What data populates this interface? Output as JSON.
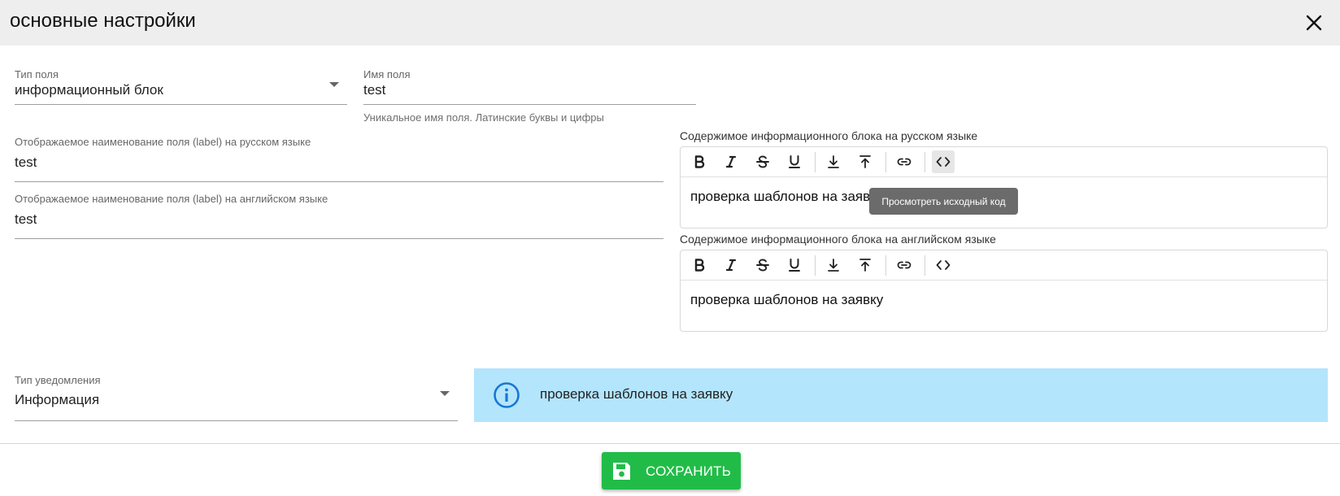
{
  "header": {
    "title": "основные настройки"
  },
  "form": {
    "field_type": {
      "label": "Тип поля",
      "value": "информационный блок"
    },
    "field_name": {
      "label": "Имя поля",
      "value": "test",
      "hint": "Уникальное имя поля. Латинские буквы и цифры"
    },
    "label_ru": {
      "label": "Отображаемое наименование поля (label) на русском языке",
      "value": "test"
    },
    "label_en": {
      "label": "Отображаемое наименование поля (label) на английском языке",
      "value": "test"
    },
    "notification_type": {
      "label": "Тип уведомления",
      "value": "Информация"
    }
  },
  "editor_ru": {
    "title": "Содержимое информационного блока на русском языке",
    "content": "проверка шаблонов на заявку"
  },
  "editor_en": {
    "title": "Содержимое информационного блока на английском языке",
    "content": "проверка шаблонов на заявку"
  },
  "toolbar_icons": [
    "bold-icon",
    "italic-icon",
    "strikethrough-icon",
    "underline-icon",
    "subscript-icon",
    "superscript-icon",
    "link-icon",
    "code-view-icon"
  ],
  "tooltip": {
    "text": "Просмотреть исходный код"
  },
  "alert": {
    "text": "проверка шаблонов на заявку",
    "icon": "info-icon",
    "color": "#b3e5fc"
  },
  "footer": {
    "save_label": "СОХРАНИТЬ",
    "save_color": "#21bc48"
  }
}
